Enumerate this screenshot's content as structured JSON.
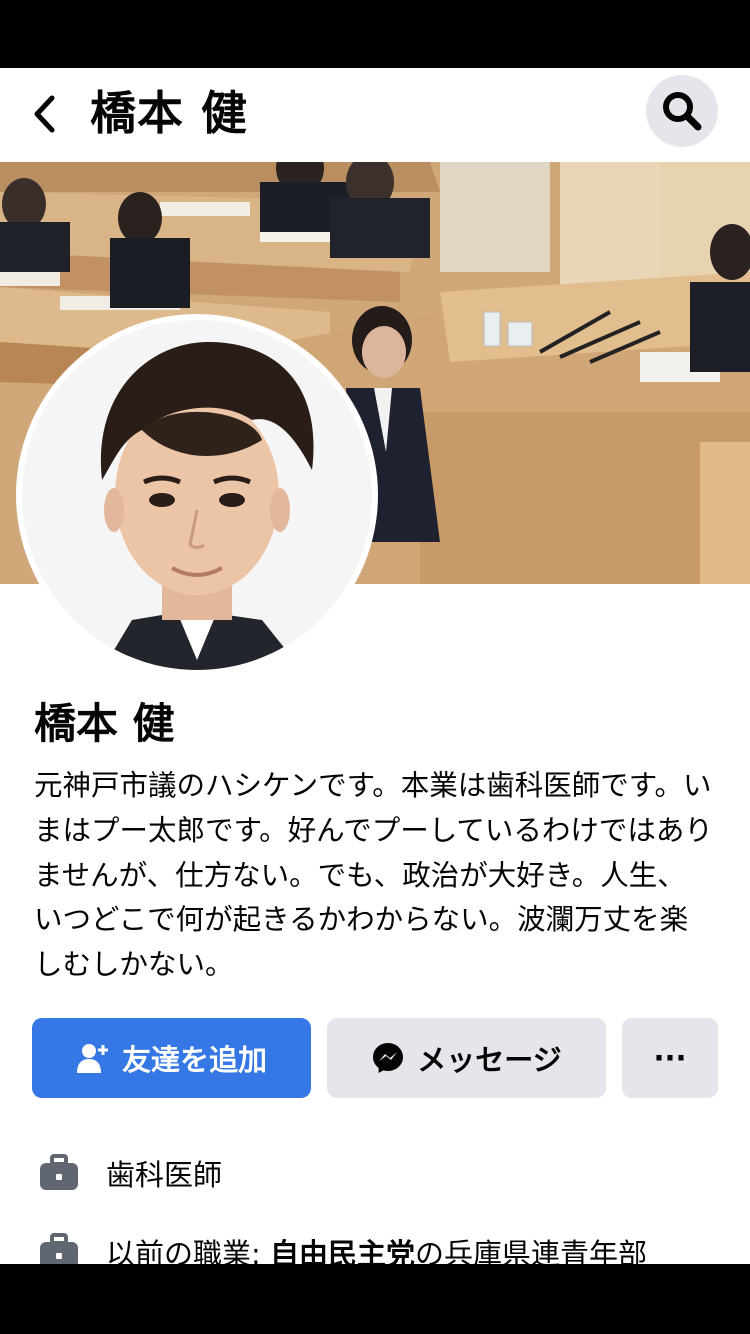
{
  "header": {
    "title": "橋本 健",
    "back_icon": "chevron-left-icon",
    "search_icon": "search-icon"
  },
  "profile": {
    "name": "橋本 健",
    "bio": "元神戸市議のハシケンです。本業は歯科医師です。いまはプー太郎です。好んでプーしているわけではありませんが、仕方ない。でも、政治が大好き。人生、いつどこで何が起きるかわからない。波瀾万丈を楽しむしかない。"
  },
  "actions": {
    "add_friend_label": "友達を追加",
    "message_label": "メッセージ",
    "more_label": "···"
  },
  "info": {
    "job": "歯科医師",
    "prev_prefix": "以前の職業: ",
    "prev_org": "自由民主党",
    "prev_suffix": "の兵庫県連青年部"
  },
  "colors": {
    "primary": "#3578e5",
    "secondary_bg": "#e4e6eb",
    "text": "#050505",
    "icon_gray": "#606770"
  }
}
